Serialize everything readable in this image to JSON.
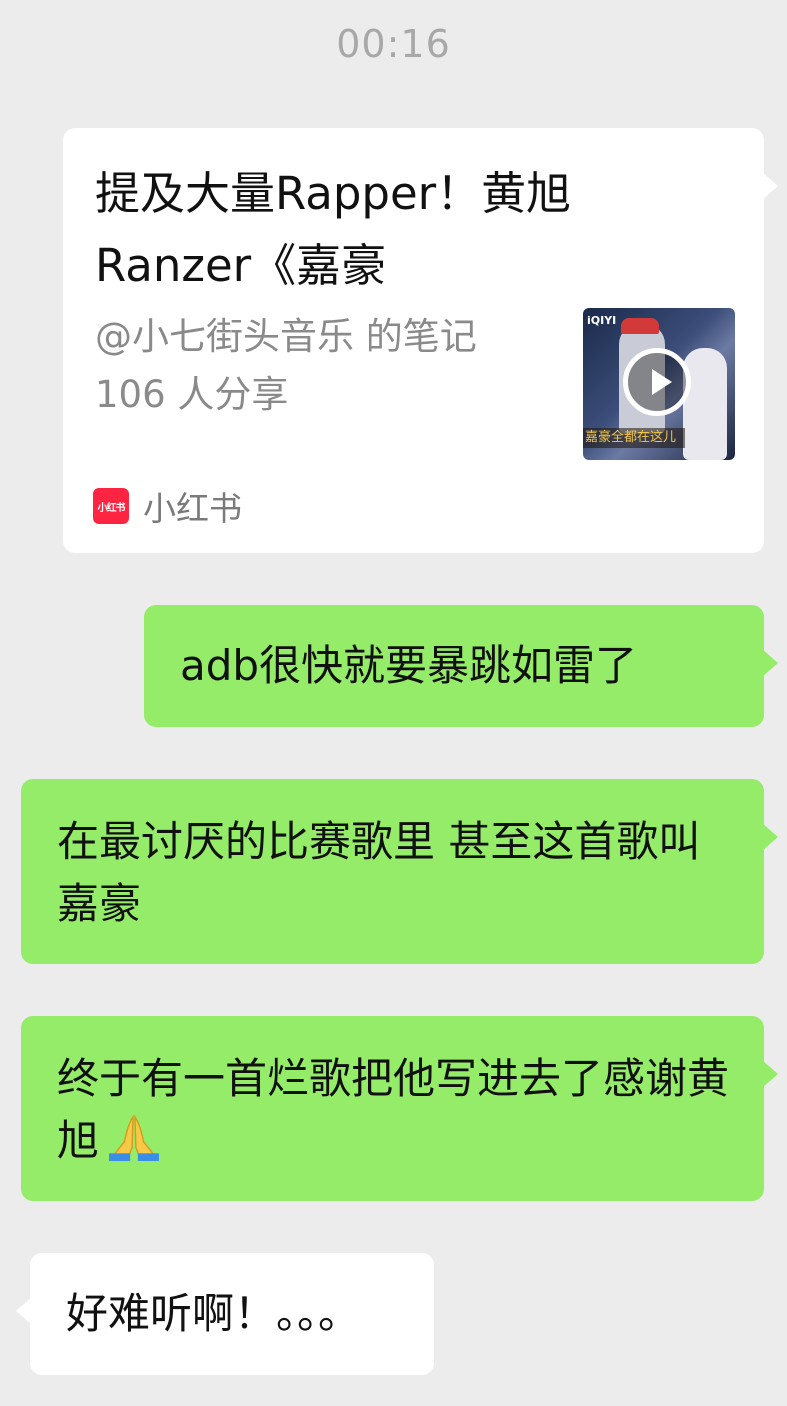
{
  "timestamp": "00:16",
  "link_card": {
    "title_line1": "提及大量Rapper！黄旭",
    "title_line2": "Ranzer《嘉豪",
    "author": "@小七街头音乐 的笔记",
    "shares": "106 人分享",
    "thumbnail_brand": "iQIYI",
    "thumbnail_caption": "嘉豪全都在这儿",
    "source_logo_text": "小红书",
    "source_name": "小红书"
  },
  "messages": [
    {
      "side": "sent",
      "text": "adb很快就要暴跳如雷了"
    },
    {
      "side": "sent",
      "text": "在最讨厌的比赛歌里 甚至这首歌叫嘉豪"
    },
    {
      "side": "sent",
      "text": "终于有一首烂歌把他写进去了感谢黄旭",
      "emoji": "folded-hands-icon"
    },
    {
      "side": "received",
      "text": "好难听啊！。。。"
    }
  ],
  "colors": {
    "background": "#ececec",
    "sent_bubble": "#95ec69",
    "received_bubble": "#ffffff",
    "timestamp": "#a8a8a8",
    "source_logo": "#ff2442"
  }
}
